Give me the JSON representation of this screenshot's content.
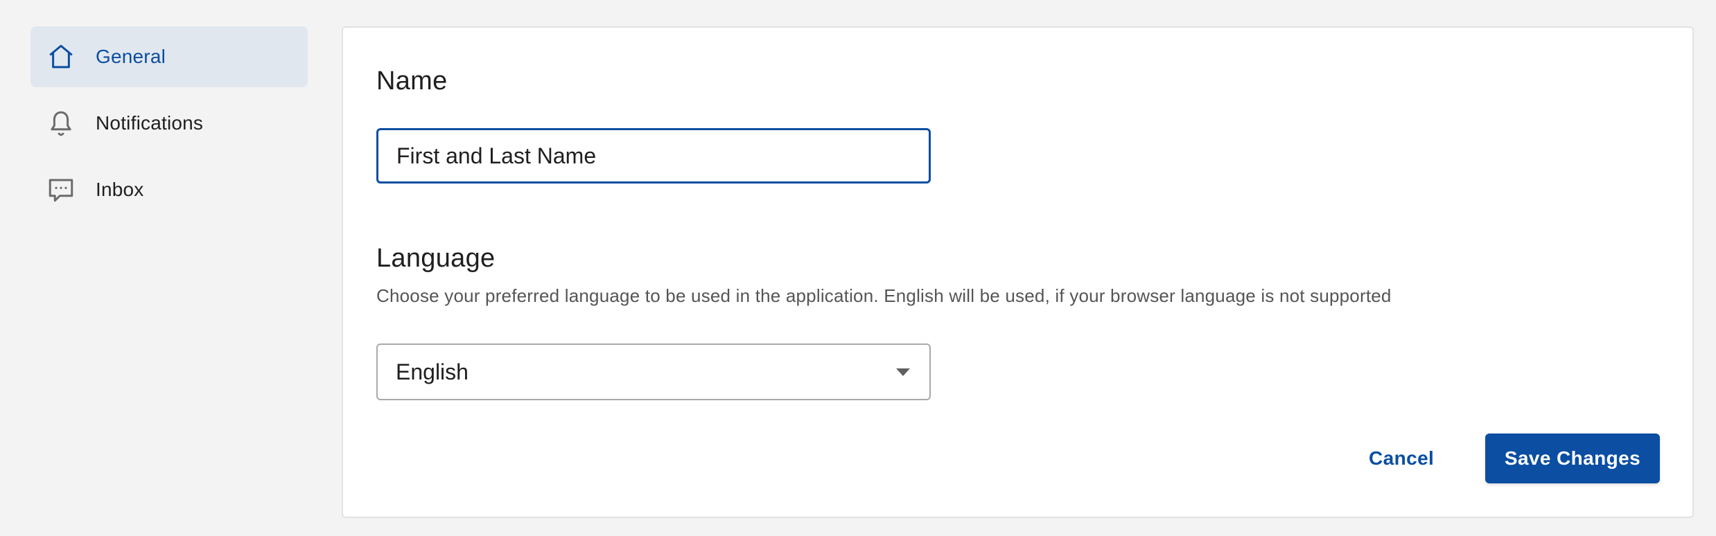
{
  "sidebar": {
    "items": [
      {
        "label": "General",
        "icon": "home-icon",
        "active": true
      },
      {
        "label": "Notifications",
        "icon": "bell-icon",
        "active": false
      },
      {
        "label": "Inbox",
        "icon": "chat-icon",
        "active": false
      }
    ]
  },
  "name_section": {
    "title": "Name",
    "input_value": "First and Last Name"
  },
  "language_section": {
    "title": "Language",
    "description": "Choose your preferred language to be used in the application. English will be used, if your browser language is not supported",
    "selected": "English"
  },
  "actions": {
    "cancel_label": "Cancel",
    "save_label": "Save Changes"
  },
  "colors": {
    "accent": "#0b4ea2",
    "active_nav_bg": "#e1e7ef",
    "page_bg": "#f3f3f3"
  }
}
